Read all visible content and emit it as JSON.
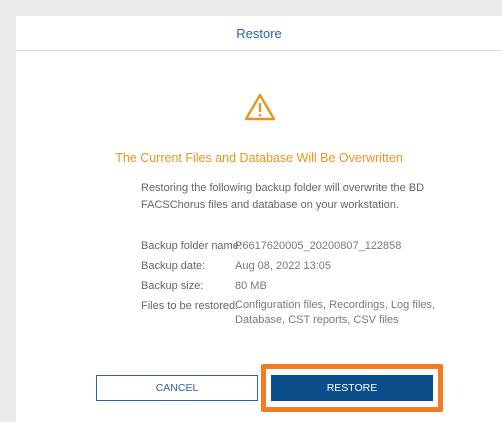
{
  "dialog": {
    "title": "Restore"
  },
  "warning": {
    "icon": "warning-triangle-icon",
    "heading": "The Current Files and Database Will Be Overwritten",
    "description": "Restoring the following backup folder will overwrite the BD FACSChorus files and database on your workstation."
  },
  "details": {
    "folder_label": "Backup folder name:",
    "folder_value": "P6617620005_20200807_122858",
    "date_label": "Backup date:",
    "date_value": "Aug 08, 2022 13:05",
    "size_label": "Backup size:",
    "size_value": "80 MB",
    "files_label": "Files to be restored:",
    "files_value": "Configuration files, Recordings, Log files, Database, CST reports, CSV files"
  },
  "buttons": {
    "cancel_label": "CANCEL",
    "restore_label": "RESTORE"
  },
  "colors": {
    "accent": "#2f63a8",
    "warning": "#e8951e",
    "primary_button": "#0b4f8a",
    "highlight": "#f47b20"
  }
}
